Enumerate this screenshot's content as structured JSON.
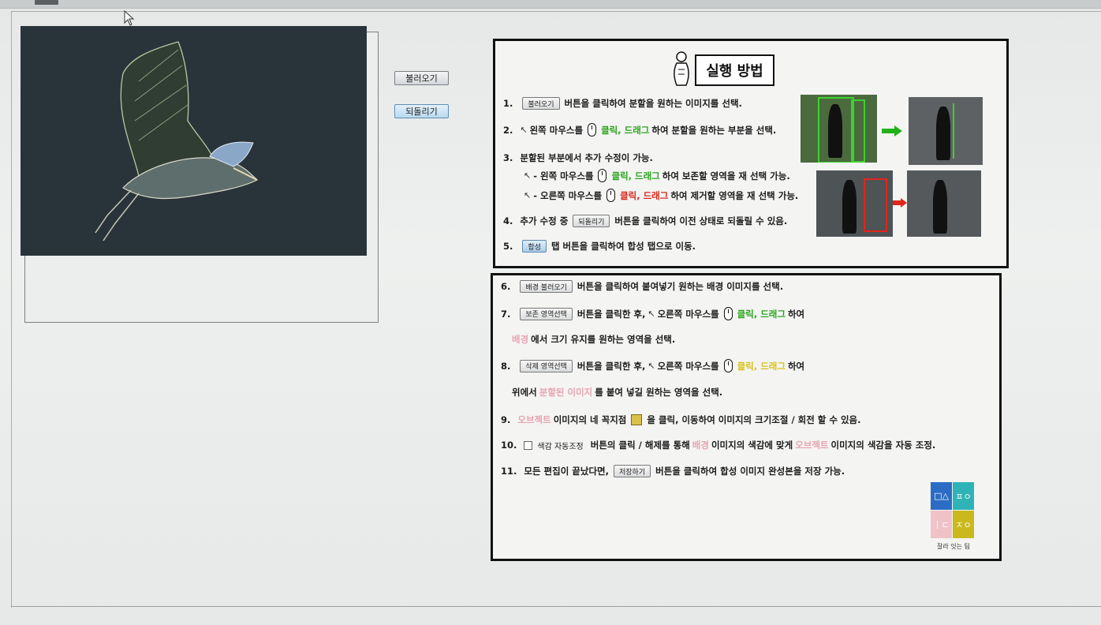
{
  "left": {
    "load_button": "불러오기",
    "undo_button": "되돌리기"
  },
  "guide": {
    "title": "실행 방법",
    "steps": {
      "s1": {
        "num": "1.",
        "btn": "불러오기",
        "text": "버튼을 클릭하여 분할을 원하는 이미지를 선택."
      },
      "s2": {
        "num": "2.",
        "pre": "왼쪽 마우스를",
        "hl": "클릭, 드래그",
        "post": "하여 분할을 원하는 부분을 선택."
      },
      "s3": {
        "num": "3.",
        "text": "분할된 부분에서 추가 수정이 가능."
      },
      "s3a": {
        "pre": "- 왼쪽 마우스를",
        "hl": "클릭, 드래그",
        "post": "하여 보존할 영역을 재 선택 가능."
      },
      "s3b": {
        "pre": "- 오른쪽 마우스를",
        "hl": "클릭, 드래그",
        "post": "하여 제거할 영역을 재 선택 가능."
      },
      "s4": {
        "num": "4.",
        "pre": "추가 수정 중",
        "btn": "되돌리기",
        "post": "버튼을 클릭하여 이전 상태로 되돌릴 수 있음."
      },
      "s5": {
        "num": "5.",
        "btn": "합성",
        "text": "탭 버튼을 클릭하여 합성 탭으로 이동."
      },
      "s6": {
        "num": "6.",
        "btn": "배경 불러오기",
        "text": "버튼을 클릭하여 붙여넣기 원하는 배경 이미지를 선택."
      },
      "s7": {
        "num": "7.",
        "btn": "보존 영역선택",
        "pre": "버튼을 클릭한 후,",
        "mid": "오른쪽 마우스를",
        "hl": "클릭, 드래그",
        "post": "하여"
      },
      "s7b": {
        "hl": "배경",
        "text": "에서 크기 유지를 원하는 영역을 선택."
      },
      "s8": {
        "num": "8.",
        "btn": "삭제 영역선택",
        "pre": "버튼을 클릭한 후,",
        "mid": "오른쪽 마우스를",
        "hl": "클릭, 드래그",
        "post": "하여"
      },
      "s8b": {
        "pre": "위에서",
        "hl": "분할된 이미지",
        "post": "를 붙여 넣길 원하는 영역을 선택."
      },
      "s9": {
        "num": "9.",
        "hl": "오브젝트",
        "pre": "이미지의 네 꼭지점",
        "post": "을 클릭, 이동하여 이미지의 크기조절 / 회전 할 수 있음."
      },
      "s10": {
        "num": "10.",
        "chk": "색감 자동조정",
        "pre": "버튼의 클릭 / 해제를 통해",
        "hl1": "배경",
        "mid": "이미지의 색감에 맞게",
        "hl2": "오브젝트",
        "post": "이미지의 색감을 자동 조정."
      },
      "s11": {
        "num": "11.",
        "pre": "모든 편집이 끝났다면,",
        "btn": "저장하기",
        "post": "버튼을 클릭하여 합성 이미지 완성본을 저장 가능."
      }
    },
    "logo": {
      "tl": "□△",
      "tr": "ㅍㅇ",
      "bl": "ㅣㄷ",
      "br": "ㅈㅇ",
      "caption": "잘라 잇는 팀"
    }
  }
}
